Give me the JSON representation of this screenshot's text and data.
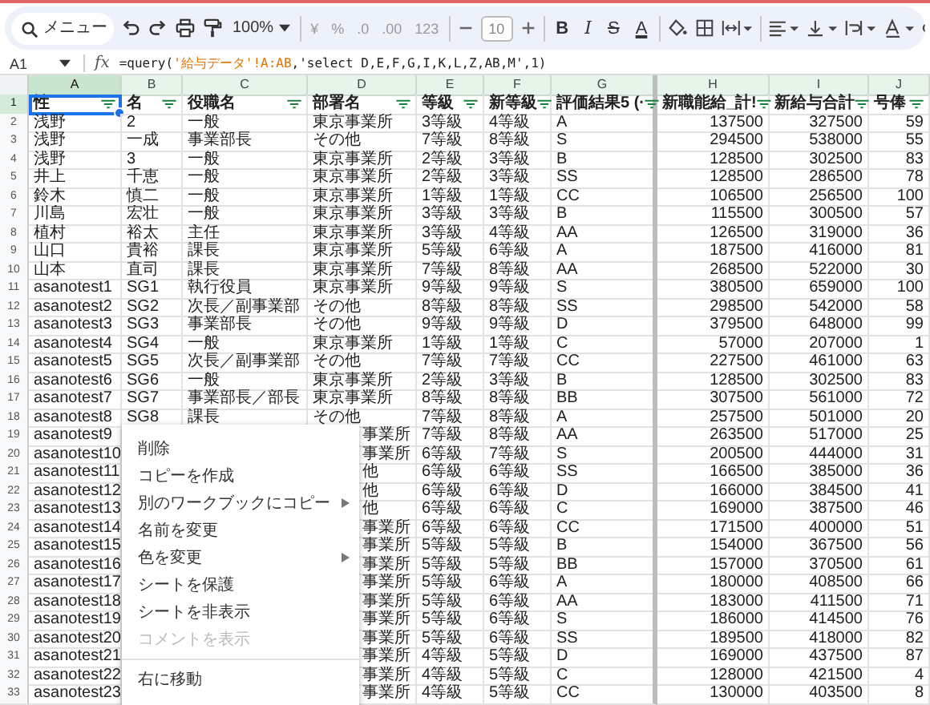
{
  "toolbar": {
    "search": {
      "placeholder": "メニュー"
    },
    "zoom": "100%",
    "number_formats": [
      "¥",
      "%",
      ".0",
      ".00",
      "123"
    ],
    "font_size": "10",
    "text_styles": [
      "B",
      "I",
      "S",
      "A"
    ]
  },
  "formula_bar": {
    "cell": "A1",
    "fx": "fx",
    "formula": [
      {
        "kind": "text",
        "text": "=query("
      },
      {
        "kind": "range",
        "text": "'給与データ'!A:AB"
      },
      {
        "kind": "text",
        "text": ",'select D,E,F,G,I,K,L,Z,AB,M',1)"
      }
    ]
  },
  "columns": [
    {
      "letter": "A",
      "selected": true
    },
    {
      "letter": "B",
      "selected": false
    },
    {
      "letter": "C",
      "selected": false
    },
    {
      "letter": "D",
      "selected": false
    },
    {
      "letter": "E",
      "selected": false
    },
    {
      "letter": "F",
      "selected": false
    },
    {
      "letter": "G",
      "selected": false
    },
    {
      "letter": "H",
      "selected": false
    },
    {
      "letter": "I",
      "selected": false
    },
    {
      "letter": "J",
      "selected": false
    }
  ],
  "header_row": {
    "n": "1",
    "selected": true,
    "cells": [
      "性",
      "名",
      "役職名",
      "部署名",
      "等級",
      "新等級",
      "評価結果5 (·",
      "新職能給_計!",
      "新給与合計",
      "号俸"
    ]
  },
  "rows": [
    {
      "n": "2",
      "selected": false,
      "cells": [
        "浅野",
        "2",
        "一般",
        "東京事業所",
        "3等級",
        "4等級",
        "A",
        "137500",
        "327500",
        "59"
      ]
    },
    {
      "n": "3",
      "selected": false,
      "cells": [
        "浅野",
        "一成",
        "事業部長",
        "その他",
        "7等級",
        "8等級",
        "S",
        "294500",
        "538000",
        "55"
      ]
    },
    {
      "n": "4",
      "selected": false,
      "cells": [
        "浅野",
        "3",
        "一般",
        "東京事業所",
        "2等級",
        "3等級",
        "B",
        "128500",
        "302500",
        "83"
      ]
    },
    {
      "n": "5",
      "selected": false,
      "cells": [
        "井上",
        "千恵",
        "一般",
        "東京事業所",
        "2等級",
        "3等級",
        "SS",
        "128500",
        "286500",
        "78"
      ]
    },
    {
      "n": "6",
      "selected": false,
      "cells": [
        "鈴木",
        "慎二",
        "一般",
        "東京事業所",
        "1等級",
        "1等級",
        "CC",
        "106500",
        "256500",
        "100"
      ]
    },
    {
      "n": "7",
      "selected": false,
      "cells": [
        "川島",
        "宏壮",
        "一般",
        "東京事業所",
        "3等級",
        "3等級",
        "B",
        "115500",
        "300500",
        "57"
      ]
    },
    {
      "n": "8",
      "selected": false,
      "cells": [
        "植村",
        "裕太",
        "主任",
        "東京事業所",
        "3等級",
        "4等級",
        "AA",
        "126500",
        "319000",
        "36"
      ]
    },
    {
      "n": "9",
      "selected": false,
      "cells": [
        "山口",
        "貴裕",
        "課長",
        "東京事業所",
        "5等級",
        "6等級",
        "A",
        "187500",
        "416000",
        "81"
      ]
    },
    {
      "n": "10",
      "selected": false,
      "cells": [
        "山本",
        "直司",
        "課長",
        "東京事業所",
        "7等級",
        "8等級",
        "AA",
        "268500",
        "522000",
        "30"
      ]
    },
    {
      "n": "11",
      "selected": false,
      "cells": [
        "asanotest1",
        "SG1",
        "執行役員",
        "東京事業所",
        "9等級",
        "9等級",
        "S",
        "380500",
        "659000",
        "100"
      ]
    },
    {
      "n": "12",
      "selected": false,
      "cells": [
        "asanotest2",
        "SG2",
        "次長／副事業部",
        "その他",
        "8等級",
        "8等級",
        "SS",
        "298500",
        "542000",
        "58"
      ]
    },
    {
      "n": "13",
      "selected": false,
      "cells": [
        "asanotest3",
        "SG3",
        "事業部長",
        "その他",
        "9等級",
        "9等級",
        "D",
        "379500",
        "648000",
        "99"
      ]
    },
    {
      "n": "14",
      "selected": false,
      "cells": [
        "asanotest4",
        "SG4",
        "一般",
        "東京事業所",
        "1等級",
        "1等級",
        "C",
        "57000",
        "207000",
        "1"
      ]
    },
    {
      "n": "15",
      "selected": false,
      "cells": [
        "asanotest5",
        "SG5",
        "次長／副事業部",
        "その他",
        "7等級",
        "7等級",
        "CC",
        "227500",
        "461000",
        "63"
      ]
    },
    {
      "n": "16",
      "selected": false,
      "cells": [
        "asanotest6",
        "SG6",
        "一般",
        "東京事業所",
        "2等級",
        "3等級",
        "B",
        "128500",
        "302500",
        "83"
      ]
    },
    {
      "n": "17",
      "selected": false,
      "cells": [
        "asanotest7",
        "SG7",
        "事業部長／部長",
        "東京事業所",
        "8等級",
        "8等級",
        "BB",
        "307500",
        "561000",
        "72"
      ]
    },
    {
      "n": "18",
      "selected": false,
      "cells": [
        "asanotest8",
        "SG8",
        "課長",
        "その他",
        "7等級",
        "8等級",
        "A",
        "257500",
        "501000",
        "20"
      ]
    },
    {
      "n": "19",
      "selected": false,
      "cells": [
        "asanotest9",
        null,
        null,
        "事業所",
        "7等級",
        "8等級",
        "AA",
        "263500",
        "517000",
        "25"
      ]
    },
    {
      "n": "20",
      "selected": false,
      "cells": [
        "asanotest10",
        null,
        null,
        "事業所",
        "6等級",
        "7等級",
        "S",
        "200500",
        "444000",
        "31"
      ]
    },
    {
      "n": "21",
      "selected": false,
      "cells": [
        "asanotest11",
        null,
        null,
        "他",
        "6等級",
        "6等級",
        "SS",
        "166500",
        "385000",
        "36"
      ]
    },
    {
      "n": "22",
      "selected": false,
      "cells": [
        "asanotest12",
        null,
        null,
        "他",
        "6等級",
        "6等級",
        "D",
        "166000",
        "384500",
        "41"
      ]
    },
    {
      "n": "23",
      "selected": false,
      "cells": [
        "asanotest13",
        null,
        null,
        "他",
        "6等級",
        "6等級",
        "C",
        "169000",
        "387500",
        "46"
      ]
    },
    {
      "n": "24",
      "selected": false,
      "cells": [
        "asanotest14",
        null,
        null,
        "事業所",
        "6等級",
        "6等級",
        "CC",
        "171500",
        "400000",
        "51"
      ]
    },
    {
      "n": "25",
      "selected": false,
      "cells": [
        "asanotest15",
        null,
        null,
        "事業所",
        "5等級",
        "5等級",
        "B",
        "154000",
        "367500",
        "56"
      ]
    },
    {
      "n": "26",
      "selected": false,
      "cells": [
        "asanotest16",
        null,
        null,
        "事業所",
        "5等級",
        "5等級",
        "BB",
        "157000",
        "370500",
        "61"
      ]
    },
    {
      "n": "27",
      "selected": false,
      "cells": [
        "asanotest17",
        null,
        null,
        "事業所",
        "5等級",
        "6等級",
        "A",
        "180000",
        "408500",
        "66"
      ]
    },
    {
      "n": "28",
      "selected": false,
      "cells": [
        "asanotest18",
        null,
        null,
        "事業所",
        "5等級",
        "6等級",
        "AA",
        "183000",
        "411500",
        "71"
      ]
    },
    {
      "n": "29",
      "selected": false,
      "cells": [
        "asanotest19",
        null,
        null,
        "事業所",
        "5等級",
        "6等級",
        "S",
        "186000",
        "414500",
        "76"
      ]
    },
    {
      "n": "30",
      "selected": false,
      "cells": [
        "asanotest20",
        null,
        null,
        "事業所",
        "5等級",
        "6等級",
        "SS",
        "189500",
        "418000",
        "82"
      ]
    },
    {
      "n": "31",
      "selected": false,
      "cells": [
        "asanotest21",
        null,
        null,
        "事業所",
        "4等級",
        "5等級",
        "D",
        "169000",
        "437500",
        "87"
      ]
    },
    {
      "n": "32",
      "selected": false,
      "cells": [
        "asanotest22",
        null,
        null,
        "事業所",
        "4等級",
        "5等級",
        "C",
        "128000",
        "421500",
        "4"
      ]
    },
    {
      "n": "33",
      "selected": false,
      "cells": [
        "asanotest23",
        null,
        null,
        "事業所",
        "4等級",
        "5等級",
        "CC",
        "130000",
        "403500",
        "8"
      ]
    }
  ],
  "context_menu": [
    {
      "kind": "item",
      "label": "削除",
      "disabled": false,
      "submenu": false
    },
    {
      "kind": "item",
      "label": "コピーを作成",
      "disabled": false,
      "submenu": false
    },
    {
      "kind": "item",
      "label": "別のワークブックにコピー",
      "disabled": false,
      "submenu": true
    },
    {
      "kind": "item",
      "label": "名前を変更",
      "disabled": false,
      "submenu": false
    },
    {
      "kind": "item",
      "label": "色を変更",
      "disabled": false,
      "submenu": true
    },
    {
      "kind": "item",
      "label": "シートを保護",
      "disabled": false,
      "submenu": false
    },
    {
      "kind": "item",
      "label": "シートを非表示",
      "disabled": false,
      "submenu": false
    },
    {
      "kind": "item",
      "label": "コメントを表示",
      "disabled": true,
      "submenu": false
    },
    {
      "kind": "divider"
    },
    {
      "kind": "item",
      "label": "右に移動",
      "disabled": false,
      "submenu": false
    }
  ]
}
